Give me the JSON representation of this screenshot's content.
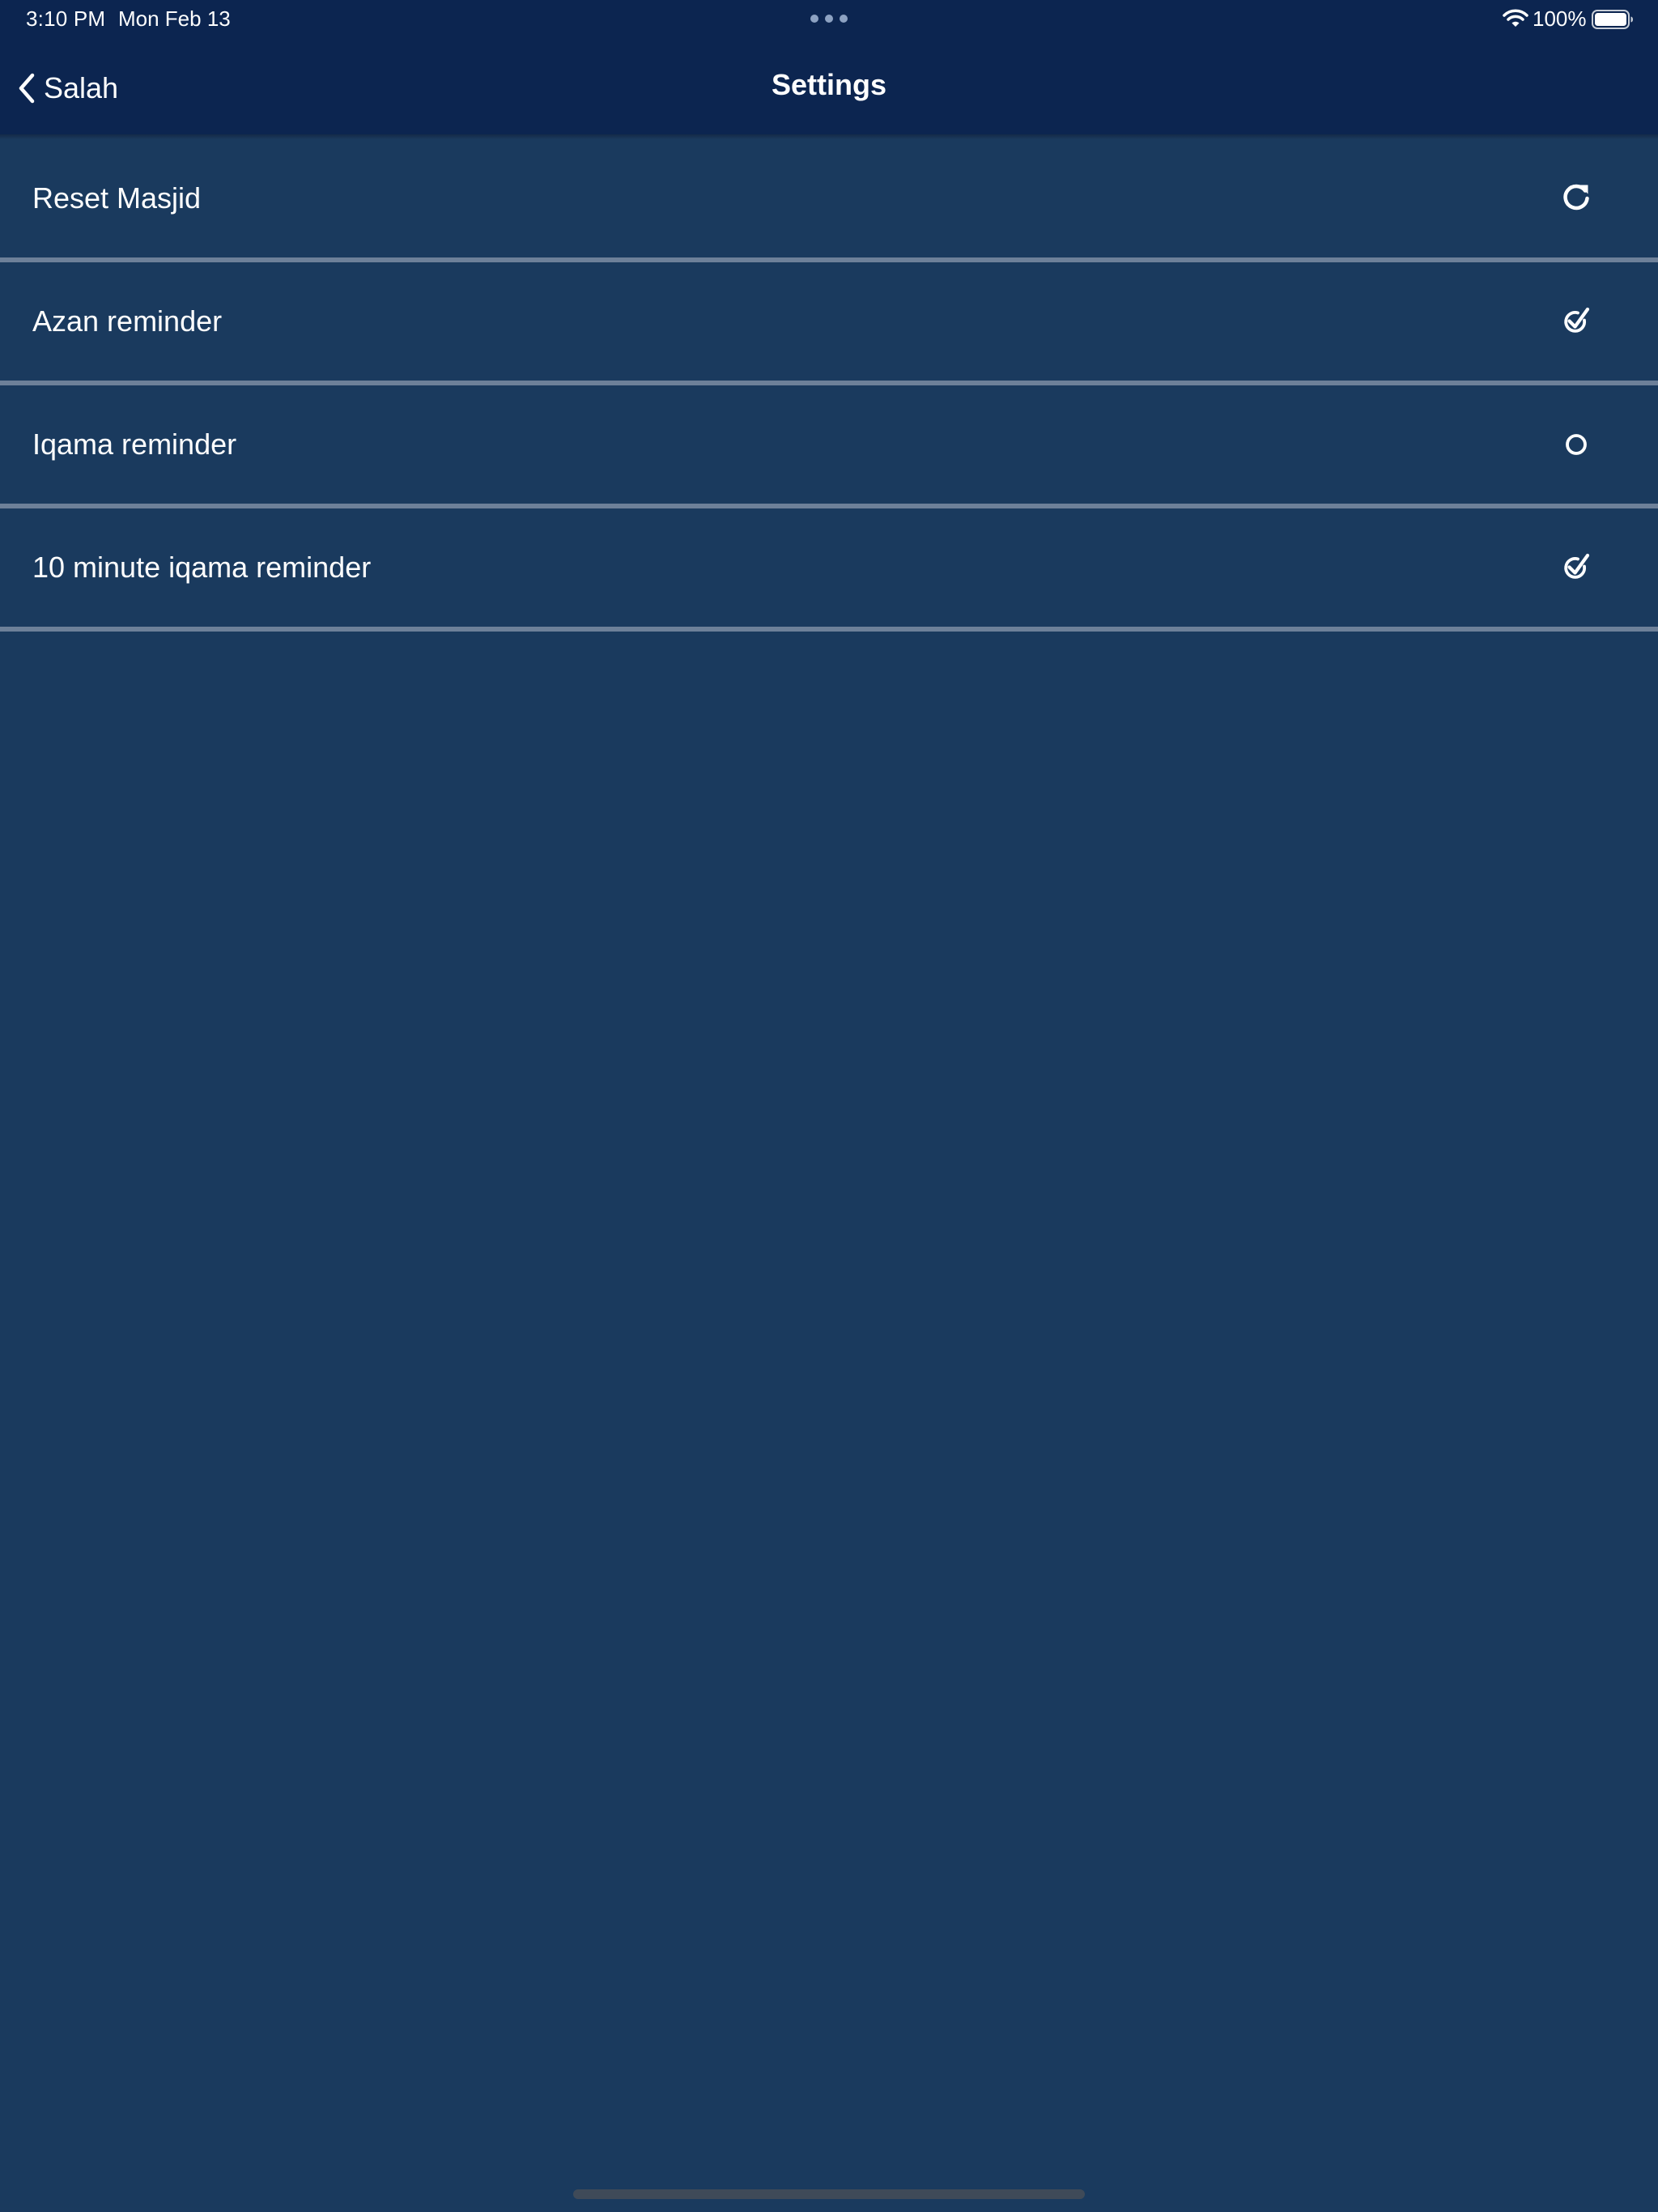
{
  "status_bar": {
    "time": "3:10 PM",
    "date": "Mon Feb 13",
    "battery_percent": "100%",
    "battery_level": 1.0,
    "wifi_icon": "wifi-icon",
    "multitask_icon": "multitask-dots-icon"
  },
  "nav": {
    "back_label": "Salah",
    "back_icon": "chevron-left-icon",
    "title": "Settings"
  },
  "settings": {
    "items": [
      {
        "label": "Reset Masjid",
        "icon": "refresh-icon",
        "state": "action"
      },
      {
        "label": "Azan reminder",
        "icon": "check-circle-icon",
        "state": "checked"
      },
      {
        "label": "Iqama reminder",
        "icon": "circle-icon",
        "state": "unchecked"
      },
      {
        "label": "10 minute iqama reminder",
        "icon": "check-circle-icon",
        "state": "checked"
      }
    ]
  },
  "colors": {
    "header_bg": "#0c2550",
    "page_bg": "#1a3a5e",
    "divider": "#6d8099",
    "text": "#ffffff"
  }
}
